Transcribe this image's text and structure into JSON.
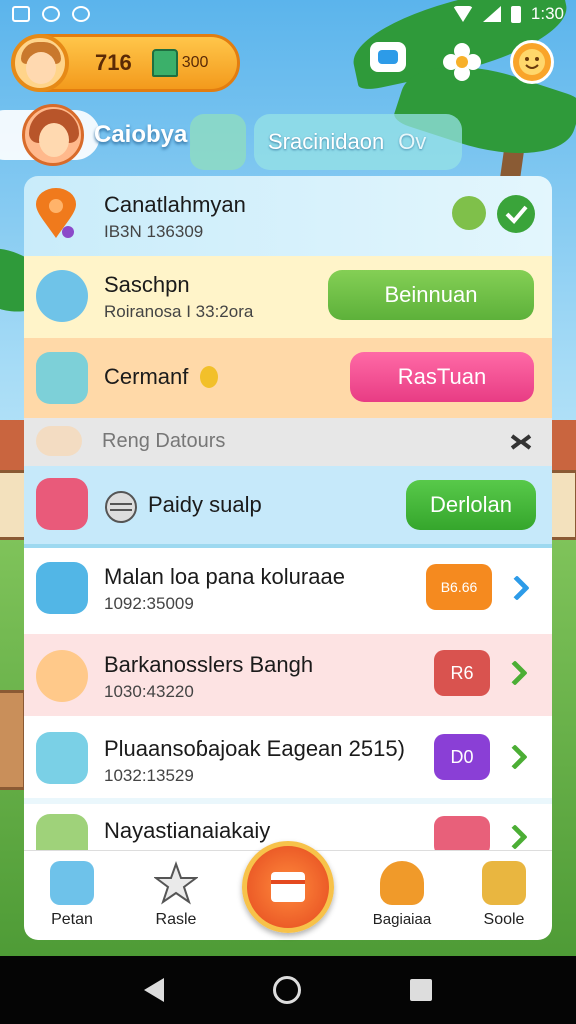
{
  "status_bar": {
    "time": "1:30"
  },
  "hud": {
    "coins": "716",
    "gems": "300"
  },
  "profile": {
    "name": "Caiobya",
    "search_text": "Sracinidaon",
    "search_extra": "Ov"
  },
  "rows": [
    {
      "title": "Canatlahmyan",
      "sub": "IB3N 136309"
    },
    {
      "title": "Saschpn",
      "sub": "Roiranosa I 33:2ora",
      "button": "Beinnuan"
    },
    {
      "title": "Cermanf",
      "button": "RasTuan"
    },
    {
      "title": "Reng Datours"
    },
    {
      "title": "Paidy sualp",
      "button": "Derlolan"
    },
    {
      "title": "Malan loa pana koluraae",
      "sub": "1092:35009",
      "badge": "B6.66"
    },
    {
      "title": "Barkanosslers Bangh",
      "sub": "1030:43220",
      "badge": "R6"
    },
    {
      "title": "Pluaansoɓajoak Eagean 2515)",
      "sub": "1032:13529",
      "badge": "D0"
    },
    {
      "title": "Nayastianaiakaiy"
    }
  ],
  "bottom_nav": [
    {
      "label": "Petan"
    },
    {
      "label": "Rasle"
    },
    {
      "label": "Bagiaiaa"
    },
    {
      "label": "Soole"
    }
  ],
  "colors": {
    "green": "#56b83a",
    "pink": "#ef4a8f",
    "orange": "#f39a1c",
    "chevron_blue": "#2d9be8",
    "chevron_green": "#4cae35"
  }
}
